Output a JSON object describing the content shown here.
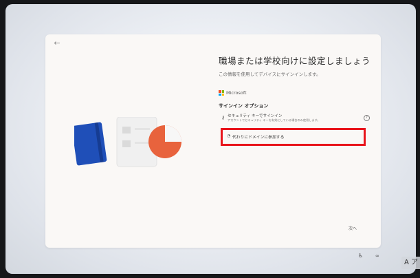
{
  "dialog": {
    "back_glyph": "←",
    "headline": "職場または学校向けに設定しましょう",
    "subtitle": "この情報を使用してデバイスにサインインします。",
    "brand": {
      "name": "Microsoft",
      "colors": [
        "#f25022",
        "#7fba00",
        "#00a4ef",
        "#ffb900"
      ]
    },
    "section_title": "サインイン オプション",
    "security_key_option": {
      "title": "セキュリティ キーでサインイン",
      "description": "アカウントでセキュリティ キーを有効にしている場合のみ使用します。",
      "help_glyph": "?"
    },
    "domain_join_option": {
      "label": "代わりにドメインに参加する"
    },
    "next_label": "次へ"
  },
  "annotation": {
    "highlight_color": "#e8141b"
  },
  "taskbar": {
    "ime_text": "A ア"
  },
  "illustration": {
    "colors": {
      "book": "#1f4fb8",
      "clipboard": "#f2f2f2",
      "pie": "#e8633d"
    }
  }
}
